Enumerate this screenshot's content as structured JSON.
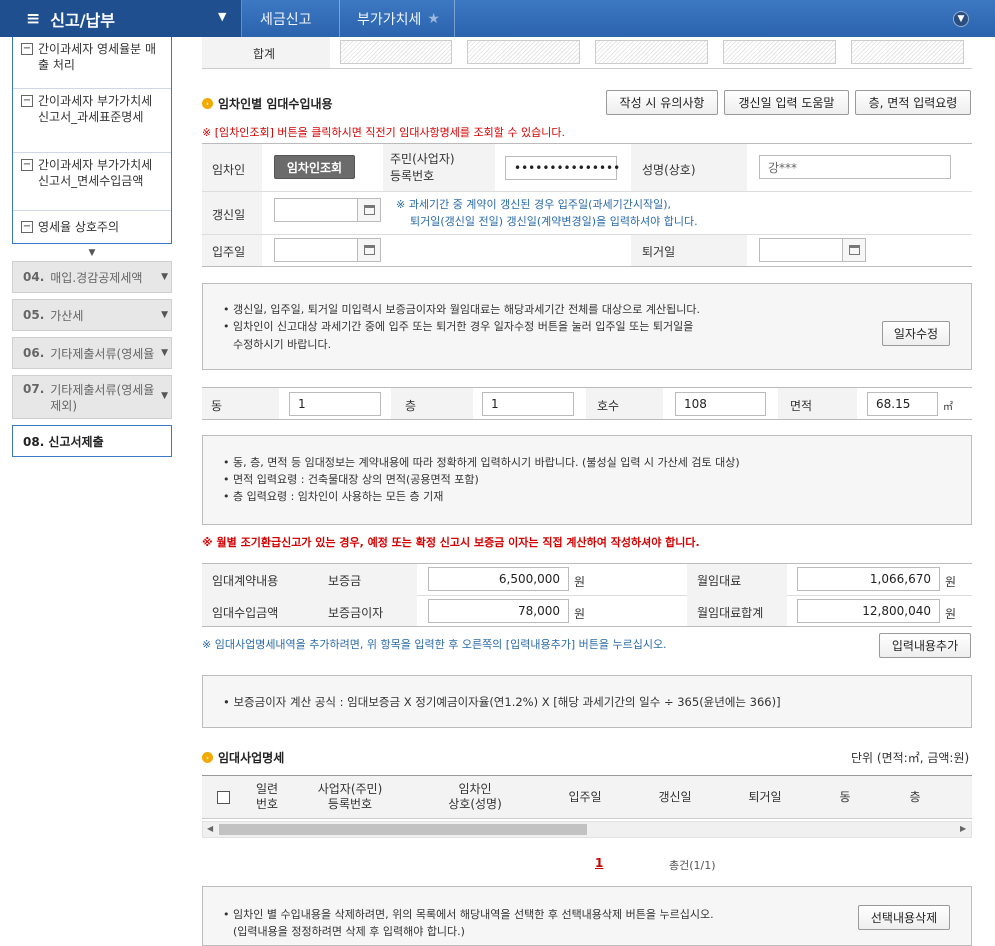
{
  "topbar": {
    "menu_title": "신고/납부",
    "breadcrumbs": [
      "세금신고",
      "부가가치세"
    ]
  },
  "sidebar": {
    "items": [
      {
        "label": "간이과세자 영세율분 매출 처리"
      },
      {
        "label": "간이과세자 부가가치세 신고서_과세표준명세"
      },
      {
        "label": "간이과세자 부가가치세 신고서_면세수입금액"
      },
      {
        "label": "영세율 상호주의"
      }
    ],
    "groups": [
      {
        "num": "04.",
        "label": "매입.경감공제세액"
      },
      {
        "num": "05.",
        "label": "가산세"
      },
      {
        "num": "06.",
        "label": "기타제출서류(영세율"
      },
      {
        "num": "07.",
        "label": "기타제출서류(영세율 제외)"
      }
    ],
    "selected": "08. 신고서제출"
  },
  "total_row": {
    "label": "합계"
  },
  "section1": {
    "title": "임차인별 임대수입내용",
    "buttons": [
      "작성 시 유의사항",
      "갱신일 입력 도움말",
      "층, 면적 입력요령"
    ],
    "warning": "※ [임차인조회] 버튼을 클릭하시면 직전기 임대사항명세를 조회할 수 있습니다.",
    "tenant_label": "임차인",
    "tenant_lookup_button": "임차인조회",
    "regno_label_1": "주민(사업자)",
    "regno_label_2": "등록번호",
    "regno_value": "•••••••••••••••",
    "name_label": "성명(상호)",
    "name_value": "강***",
    "renewal_label": "갱신일",
    "renewal_note_1": "※ 과세기간 중 계약이 갱신된 경우 입주일(과세기간시작일),",
    "renewal_note_2": "퇴거일(갱신일 전일) 갱신일(계약변경일)을 입력하셔야 합니다.",
    "movein_label": "입주일",
    "moveout_label": "퇴거일"
  },
  "info1": {
    "lines": [
      "갱신일, 입주일, 퇴거일 미입력시 보증금이자와 월임대료는 해당과세기간 전체를 대상으로 계산됩니다.",
      "임차인이 신고대상 과세기간 중에 입주 또는 퇴거한 경우 일자수정 버튼을 눌러 입주일 또는 퇴거일을",
      "수정하시기 바랍니다."
    ],
    "button": "일자수정"
  },
  "unit_row": {
    "dong_label": "동",
    "dong_value": "1",
    "floor_label": "층",
    "floor_value": "1",
    "ho_label": "호수",
    "ho_value": "108",
    "area_label": "면적",
    "area_value": "68.15",
    "area_unit": "㎡"
  },
  "info2": {
    "lines": [
      "동, 층, 면적 등 임대정보는 계약내용에 따라 정확하게 입력하시기 바랍니다. (불성실 입력 시 가산세 검토 대상)",
      "면적 입력요령 : 건축물대장 상의 면적(공용면적 포함)",
      "층 입력요령 : 임차인이 사용하는 모든 층 기재"
    ]
  },
  "warning2": "※ 월별 조기환급신고가 있는 경우, 예정 또는 확정 신고시 보증금 이자는 직접 계산하여 작성하셔야 합니다.",
  "rent": {
    "contract_label": "임대계약내용",
    "income_label": "임대수입금액",
    "deposit_label": "보증금",
    "deposit_value": "6,500,000",
    "deposit_interest_label": "보증금이자",
    "deposit_interest_value": "78,000",
    "monthly_label": "월임대료",
    "monthly_value": "1,066,670",
    "monthly_total_label": "월임대료합계",
    "monthly_total_value": "12,800,040",
    "won": "원"
  },
  "add_note": "※ 임대사업명세내역을 추가하려면, 위 항목을 입력한 후 오른쪽의 [입력내용추가] 버튼을 누르십시오.",
  "add_button": "입력내용추가",
  "formula": "보증금이자 계산 공식 : 임대보증금 X 정기예금이자율(연1.2%) X [해당 과세기간의 일수 ÷ 365(윤년에는 366)]",
  "section2": {
    "title": "임대사업명세",
    "unit": "단위 (면적:㎡, 금액:원)",
    "columns": [
      [
        "일련",
        "번호"
      ],
      [
        "사업자(주민)",
        "등록번호"
      ],
      [
        "임차인",
        "상호(성명)"
      ],
      [
        "입주일"
      ],
      [
        "갱신일"
      ],
      [
        "퇴거일"
      ],
      [
        "동"
      ],
      [
        "층"
      ]
    ],
    "page": "1",
    "count": "총건(1/1)"
  },
  "delete_info": {
    "line1": "임차인 별 수입내용을 삭제하려면, 위의 목록에서 해당내역을 선택한 후 선택내용삭제 버튼을 누르십시오.",
    "line2": "(입력내용을 정정하려면 삭제 후 입력해야 합니다.)",
    "button": "선택내용삭제"
  }
}
